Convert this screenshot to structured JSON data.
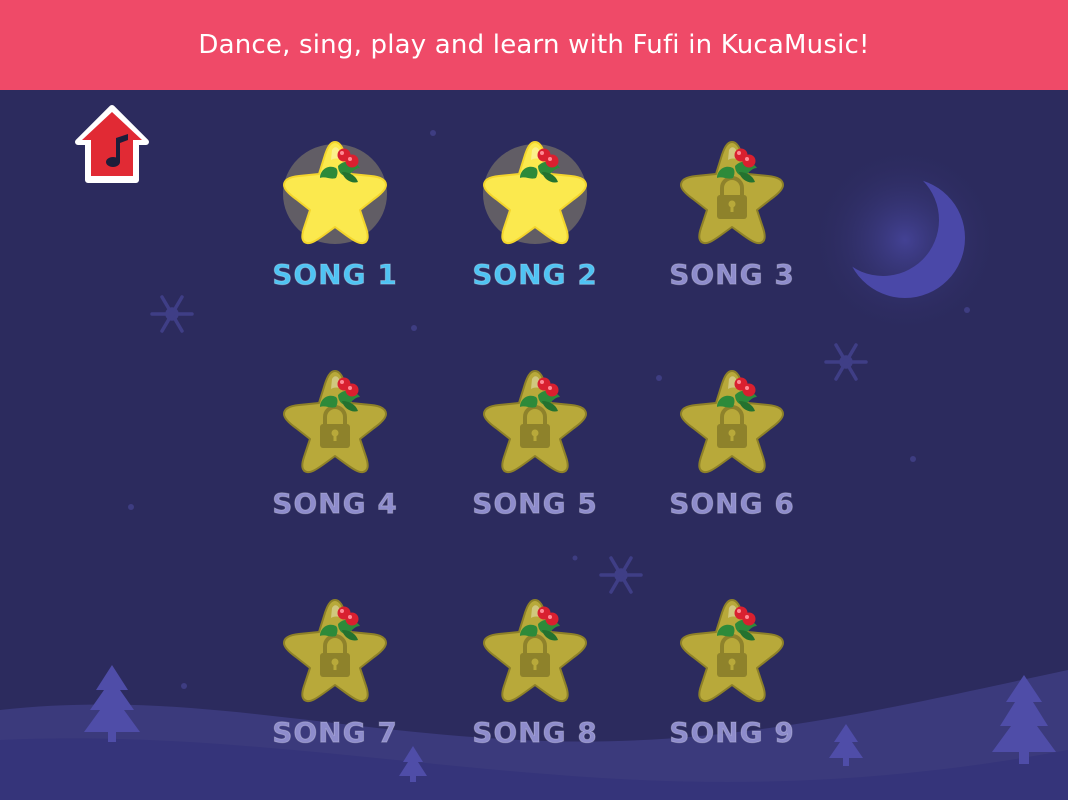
{
  "banner": {
    "text": "Dance, sing, play and learn with Fufi in KucaMusic!"
  },
  "home_button": {
    "icon": "home-music-icon"
  },
  "colors": {
    "banner": "#ef4a68",
    "background": "#2c2b5e",
    "unlocked_label": "#4fc3f3",
    "locked_label": "#8e8ccc",
    "star_unlocked": "#fbe94e",
    "star_locked": "#b8a93a",
    "moon": "#4a48a8"
  },
  "songs": [
    {
      "label": "SONG 1",
      "locked": false
    },
    {
      "label": "SONG 2",
      "locked": false
    },
    {
      "label": "SONG 3",
      "locked": true
    },
    {
      "label": "SONG 4",
      "locked": true
    },
    {
      "label": "SONG 5",
      "locked": true
    },
    {
      "label": "SONG 6",
      "locked": true
    },
    {
      "label": "SONG 7",
      "locked": true
    },
    {
      "label": "SONG 8",
      "locked": true
    },
    {
      "label": "SONG 9",
      "locked": true
    }
  ]
}
